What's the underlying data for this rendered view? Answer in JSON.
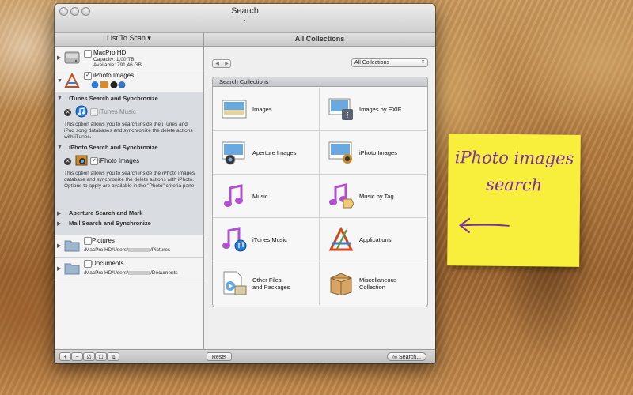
{
  "window": {
    "title": "Search",
    "title_glyph": "."
  },
  "left_header": {
    "label": "List To Scan ▾"
  },
  "right_header": {
    "label": "All Collections"
  },
  "scan_list": {
    "macpro": {
      "name": "MacPro HD",
      "capacity": "Capacity: 1,00 TB",
      "available": "Available: 791,46 GB"
    },
    "iphoto": {
      "name": "iPhoto Images"
    },
    "itunes_section": {
      "title": "iTunes Search and Synchronize",
      "item": "iTunes Music",
      "description": "This option allows you to search inside the iTunes and iPod song databases and synchronize the delete actions with iTunes."
    },
    "iphoto_section": {
      "title": "iPhoto Search and Synchronize",
      "item": "iPhoto Images",
      "description": "This option allows you to search inside the iPhoto images database and synchronize the delete actions with iPhoto.\nOptions to apply are available in the \"Photo\" criteria pane."
    },
    "aperture_section": {
      "title": "Aperture Search and Mark"
    },
    "mail_section": {
      "title": "Mail Search and Synchronize"
    },
    "pictures": {
      "name": "Pictures",
      "path_prefix": "/MacPro HD/Users/",
      "path_suffix": "/Pictures"
    },
    "documents": {
      "name": "Documents",
      "path_prefix": "/MacPro HD/Users/",
      "path_suffix": "/Documents"
    }
  },
  "bottom_bar": {
    "add": "+",
    "remove": "−",
    "check": "☑",
    "uncheck": "☐",
    "options": "⇅",
    "reset": "Reset",
    "search": "Search..."
  },
  "nav": {
    "back": "◀",
    "forward": "▶"
  },
  "collections_select": {
    "value": "All Collections"
  },
  "search_collections": {
    "title": "Search Collections",
    "items": [
      {
        "label": "Images",
        "icon": "photo-icon"
      },
      {
        "label": "Images by EXIF",
        "icon": "photo-info-icon"
      },
      {
        "label": "Aperture Images",
        "icon": "aperture-photo-icon"
      },
      {
        "label": "iPhoto Images",
        "icon": "iphoto-icon"
      },
      {
        "label": "Music",
        "icon": "music-note-icon"
      },
      {
        "label": "Music by Tag",
        "icon": "music-tag-icon"
      },
      {
        "label": "iTunes Music",
        "icon": "itunes-note-icon"
      },
      {
        "label": "Applications",
        "icon": "applications-icon"
      },
      {
        "label": "Other Files\nand Packages",
        "icon": "files-packages-icon"
      },
      {
        "label": "Miscellaneous\nCollection",
        "icon": "box-icon"
      }
    ]
  },
  "sticky_note": {
    "line1": "iPhoto images",
    "line2": "search"
  },
  "colors": {
    "note": "#f7ef3c",
    "note_ink": "#7a2fa8",
    "music_purple": "#b04fd0",
    "itunes_blue": "#2a7ad8"
  }
}
